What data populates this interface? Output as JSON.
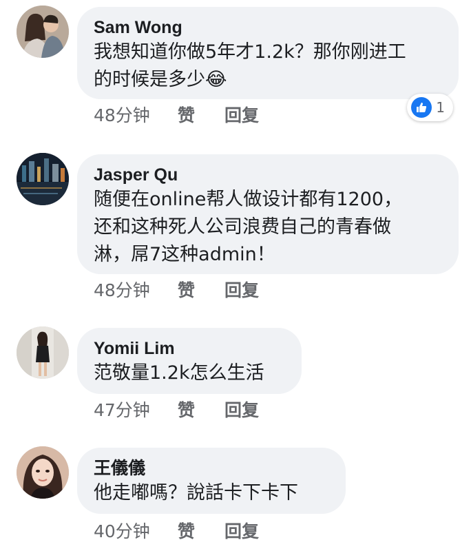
{
  "comments": [
    {
      "author": "Sam Wong",
      "text": "我想知道你做5年才1.2k？那你刚进工\n的时候是多少😂",
      "time": "48分钟",
      "like": "赞",
      "reply": "回复",
      "reaction_count": "1"
    },
    {
      "author": "Jasper Qu",
      "text": "随便在online帮人做设计都有1200，\n还和这种死人公司浪费自己的青春做\n淋，屌7这种admin！",
      "time": "48分钟",
      "like": "赞",
      "reply": "回复"
    },
    {
      "author": "Yomii Lim",
      "text": "范敬量1.2k怎么生活",
      "time": "47分钟",
      "like": "赞",
      "reply": "回复"
    },
    {
      "author": "王儀儀",
      "text": "他走嘟嗎？說話卡下卡下",
      "time": "40分钟",
      "like": "赞",
      "reply": "回复"
    }
  ],
  "colors": {
    "bubble": "#f0f2f5",
    "like_blue": "#1877f2",
    "meta": "#65676b"
  }
}
